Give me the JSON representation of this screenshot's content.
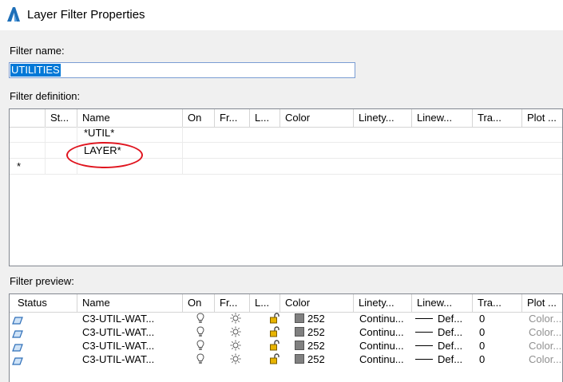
{
  "window": {
    "title": "Layer Filter Properties"
  },
  "filter_name": {
    "label": "Filter name:",
    "value": "UTILITIES"
  },
  "filter_definition": {
    "label": "Filter definition:",
    "columns": [
      "St...",
      "Name",
      "On",
      "Fr...",
      "L...",
      "Color",
      "Linety...",
      "Linew...",
      "Tra...",
      "Plot ..."
    ],
    "rows": [
      {
        "name": "*UTIL*"
      },
      {
        "name": "LAYER*"
      }
    ],
    "new_row_marker": "*"
  },
  "filter_preview": {
    "label": "Filter preview:",
    "columns": [
      "Status",
      "Name",
      "On",
      "Fr...",
      "L...",
      "Color",
      "Linety...",
      "Linew...",
      "Tra...",
      "Plot ..."
    ],
    "rows": [
      {
        "name": "C3-UTIL-WAT...",
        "color": "252",
        "linetype": "Continu...",
        "lineweight": "Def...",
        "transparency": "0",
        "plot": "Color..."
      },
      {
        "name": "C3-UTIL-WAT...",
        "color": "252",
        "linetype": "Continu...",
        "lineweight": "Def...",
        "transparency": "0",
        "plot": "Color..."
      },
      {
        "name": "C3-UTIL-WAT...",
        "color": "252",
        "linetype": "Continu...",
        "lineweight": "Def...",
        "transparency": "0",
        "plot": "Color..."
      },
      {
        "name": "C3-UTIL-WAT...",
        "color": "252",
        "linetype": "Continu...",
        "lineweight": "Def...",
        "transparency": "0",
        "plot": "Color..."
      }
    ]
  },
  "colors": {
    "selection": "#0078d7",
    "annotation": "#e0141e",
    "layer_color": "#808080"
  }
}
